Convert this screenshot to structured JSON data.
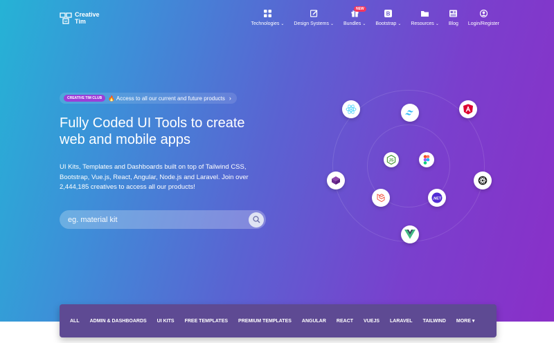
{
  "brand": {
    "name_line1": "Creative",
    "name_line2": "Tim"
  },
  "nav": [
    {
      "label": "Technologies",
      "dropdown": true,
      "icon": "grid-icon"
    },
    {
      "label": "Design Systems",
      "dropdown": true,
      "icon": "edit-icon"
    },
    {
      "label": "Bundles",
      "dropdown": true,
      "icon": "gift-icon",
      "badge": "NEW"
    },
    {
      "label": "Bootstrap",
      "dropdown": true,
      "icon": "bootstrap-icon"
    },
    {
      "label": "Resources",
      "dropdown": true,
      "icon": "folder-icon"
    },
    {
      "label": "Blog",
      "dropdown": false,
      "icon": "blog-icon"
    },
    {
      "label": "Login/Register",
      "dropdown": false,
      "icon": "user-icon"
    }
  ],
  "announcement": {
    "tag": "CREATIVE TIM CLUB",
    "text": "🔥 Access to all our current and future products",
    "arrow": "›"
  },
  "hero": {
    "title": "Fully Coded UI Tools to create web and mobile apps",
    "description": "UI Kits, Templates and Dashboards built on top of Tailwind CSS, Bootstrap, Vue.js, React, Angular, Node.js and Laravel. Join over 2,444,185 creatives to access all our products!"
  },
  "search": {
    "placeholder": "eg. material kit"
  },
  "tech_icons": [
    "react-icon",
    "tailwind-icon",
    "angular-icon",
    "nodejs-icon",
    "figma-icon",
    "material-icon",
    "chakra-icon",
    "laravel-icon",
    "dotnet-icon",
    "vue-icon"
  ],
  "categories": [
    "ALL",
    "ADMIN & DASHBOARDS",
    "UI KITS",
    "FREE TEMPLATES",
    "PREMIUM TEMPLATES",
    "ANGULAR",
    "REACT",
    "VUEJS",
    "LARAVEL",
    "TAILWIND",
    "MORE ▾"
  ],
  "colors": {
    "club_tag": "#9b3ed8",
    "new_badge": "#f5365c",
    "category_bar": "#5e4a93"
  }
}
